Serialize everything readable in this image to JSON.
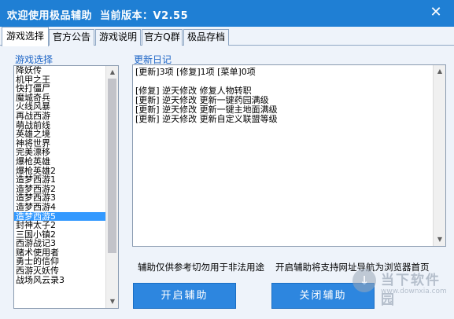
{
  "window": {
    "title": "欢迎使用极品辅助",
    "version_label": "当前版本：V2.55",
    "close_glyph": "✕"
  },
  "tabs": [
    {
      "label": "游戏选择",
      "active": true
    },
    {
      "label": "官方公告",
      "active": false
    },
    {
      "label": "游戏说明",
      "active": false
    },
    {
      "label": "官方Q群",
      "active": false
    },
    {
      "label": "极品存档",
      "active": false
    }
  ],
  "game_select": {
    "label": "游戏选择",
    "selected_index": 16,
    "items": [
      "降妖传",
      "机甲之王",
      "快打僵尸",
      "魔城奇兵",
      "火线风暴",
      "再战西游",
      "萌战前线",
      "英雄之境",
      "神将世界",
      "完美漂移",
      "爆枪英雄",
      "爆枪英雄2",
      "造梦西游1",
      "造梦西游2",
      "造梦西游3",
      "造梦西游4",
      "造梦西游5",
      "封神太子2",
      "三国小镇2",
      "西游战记3",
      "赌术使用者",
      "勇士的信仰",
      "西游灭妖传",
      "战场风云录3"
    ]
  },
  "update_log": {
    "label": "更新日记",
    "lines": [
      "[更新]3项 [修复]1项 [菜单]0项",
      "",
      "[修复] 逆天修改 修复人物转职",
      "[更新] 逆天修改 更新一键药园满级",
      "[更新] 逆天修改 更新一键主地面满级",
      "[更新] 逆天修改 更新自定义联盟等级"
    ]
  },
  "notices": {
    "left": "辅助仅供参考切勿用于非法用途",
    "right": "开启辅助将支持网址导航为浏览器首页"
  },
  "buttons": {
    "start": "开启辅助",
    "stop": "关闭辅助"
  },
  "watermark": {
    "title": "当下软件园",
    "url": "www.downxia.com"
  },
  "icons": {
    "scroll_up": "▲",
    "scroll_down": "▼",
    "watermark_logo": "↓"
  }
}
